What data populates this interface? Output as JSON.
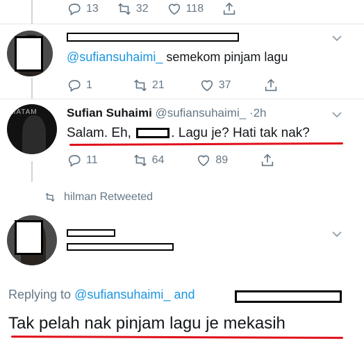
{
  "tweets": [
    {
      "actions": {
        "replies": "13",
        "retweets": "32",
        "likes": "118"
      }
    },
    {
      "reply_handle": "@sufiansuhaimi_",
      "text": "semekom pinjam lagu",
      "actions": {
        "replies": "1",
        "retweets": "21",
        "likes": "37"
      }
    },
    {
      "avatar_text": "MATAM",
      "name": "Sufian Suhaimi",
      "handle": "@sufiansuhaimi_",
      "time": "2h",
      "text_part1": "Salam. Eh,",
      "text_part2": ". Lagu je? Hati tak nak?",
      "actions": {
        "replies": "11",
        "retweets": "64",
        "likes": "89"
      }
    }
  ],
  "retweet_notice": "hilman Retweeted",
  "replying": {
    "prefix": "Replying to",
    "handle": "@sufiansuhaimi_",
    "and": "and"
  },
  "main_text": "Tak pelah nak pinjam lagu je mekasih",
  "colors": {
    "link": "#1b95e0",
    "muted": "#657786",
    "underline": "#e0101a"
  }
}
